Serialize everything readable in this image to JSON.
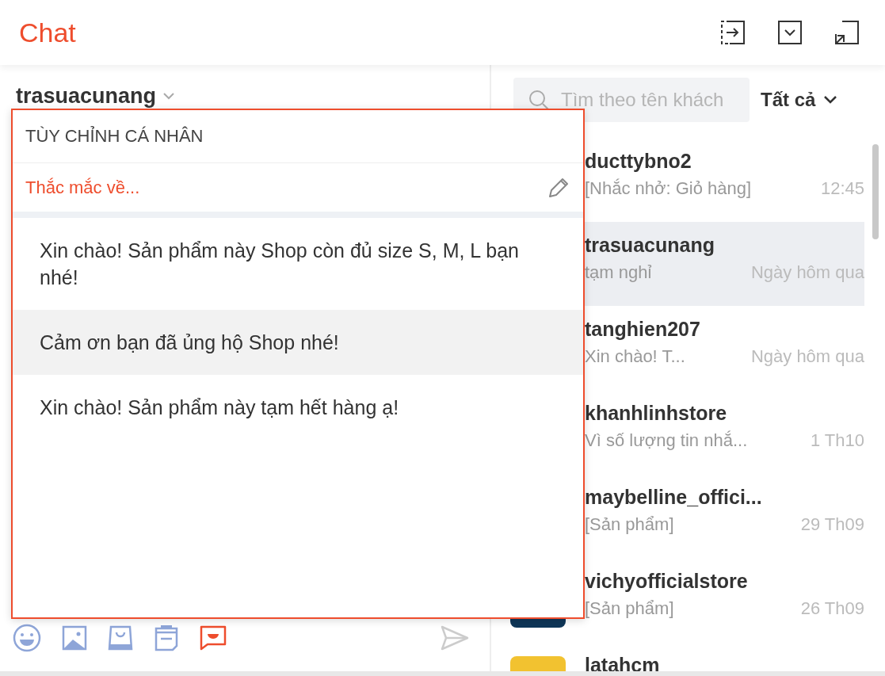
{
  "header": {
    "title": "Chat",
    "actions": [
      {
        "kind": "exit"
      },
      {
        "kind": "minimize"
      },
      {
        "kind": "shrink"
      }
    ]
  },
  "conversation": {
    "name": "trasuacunang"
  },
  "composer": {
    "tools": [
      {
        "kind": "emoji",
        "active": false
      },
      {
        "kind": "image",
        "active": false
      },
      {
        "kind": "product",
        "active": false
      },
      {
        "kind": "order",
        "active": false
      },
      {
        "kind": "quick-reply",
        "active": true
      }
    ]
  },
  "quick_replies": {
    "title": "TÙY CHỈNH CÁ NHÂN",
    "group": "Thắc mắc về...",
    "items": [
      {
        "text": "Xin chào! Sản phẩm này Shop còn đủ size S, M, L bạn nhé!",
        "selected": false
      },
      {
        "text": "Cảm ơn bạn đã ủng hộ Shop nhé!",
        "selected": true
      },
      {
        "text": "Xin chào! Sản phẩm này tạm hết hàng ạ!",
        "selected": false
      }
    ]
  },
  "search": {
    "placeholder": "Tìm theo tên khách"
  },
  "filter": {
    "label": "Tất cả"
  },
  "conversations": [
    {
      "name": "ducttybno2",
      "preview": "[Nhắc nhở: Giỏ hàng]",
      "time": "12:45",
      "selected": false
    },
    {
      "name": "trasuacunang",
      "preview": "tạm nghỉ",
      "time": "Ngày hôm qua",
      "selected": true
    },
    {
      "name": "tanghien207",
      "preview": "Xin chào! T...",
      "time": "Ngày hôm qua",
      "selected": false
    },
    {
      "name": "khanhlinhstore",
      "preview": "Vì số lượng tin nhắ...",
      "time": "1 Th10",
      "selected": false
    },
    {
      "name": "maybelline_offici...",
      "preview": "[Sản phẩm]",
      "time": "29 Th09",
      "selected": false
    },
    {
      "name": "vichyofficialstore",
      "preview": "[Sản phẩm]",
      "time": "26 Th09",
      "selected": false
    },
    {
      "name": "latahcm",
      "selected": false
    }
  ]
}
